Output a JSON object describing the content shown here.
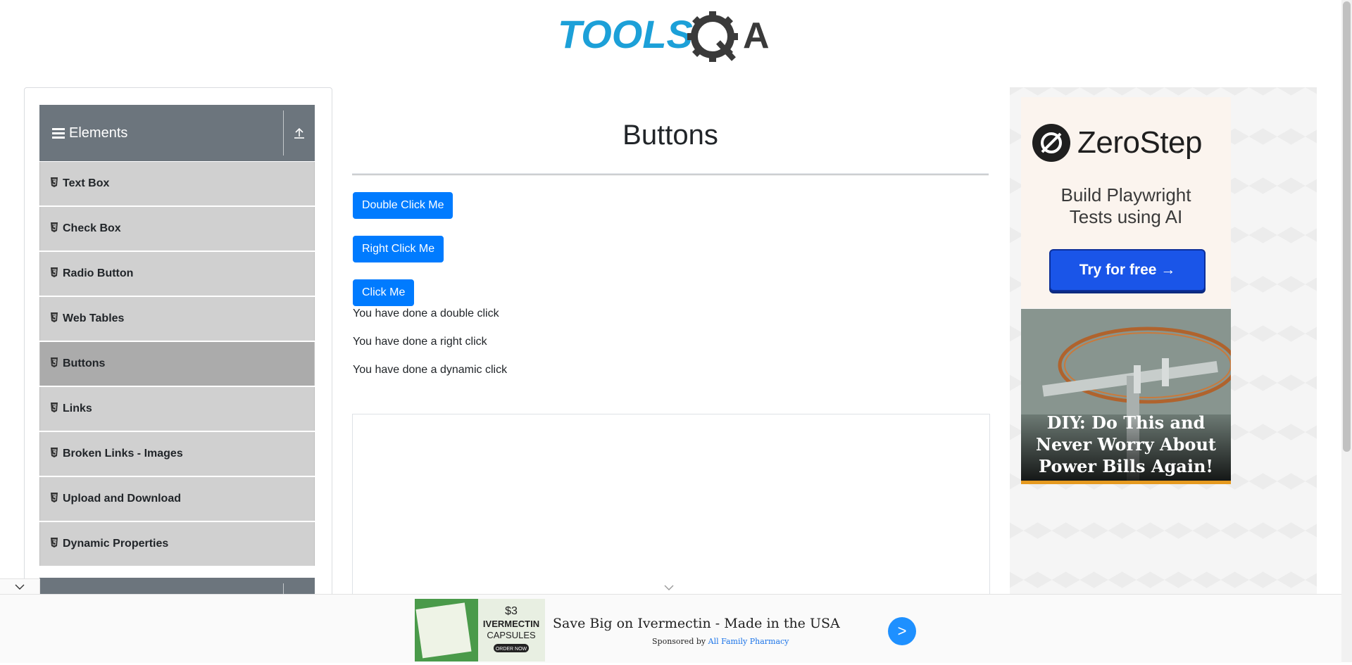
{
  "logo": {
    "text_left": "TOOLS",
    "text_right": "A"
  },
  "sidebar": {
    "group_title": "Elements",
    "items": [
      {
        "label": "Text Box",
        "active": false
      },
      {
        "label": "Check Box",
        "active": false
      },
      {
        "label": "Radio Button",
        "active": false
      },
      {
        "label": "Web Tables",
        "active": false
      },
      {
        "label": "Buttons",
        "active": true
      },
      {
        "label": "Links",
        "active": false
      },
      {
        "label": "Broken Links - Images",
        "active": false
      },
      {
        "label": "Upload and Download",
        "active": false
      },
      {
        "label": "Dynamic Properties",
        "active": false
      }
    ]
  },
  "main": {
    "title": "Buttons",
    "buttons": {
      "double_click": "Double Click Me",
      "right_click": "Right Click Me",
      "click": "Click Me"
    },
    "messages": {
      "double": "You have done a double click",
      "right": "You have done a right click",
      "dynamic": "You have done a dynamic click"
    }
  },
  "right_ad": {
    "brand": "ZeroStep",
    "tagline_line1": "Build Playwright",
    "tagline_line2": "Tests using AI",
    "cta": "Try for free →",
    "diy_headline": "DIY: Do This and Never Worry About Power Bills Again!"
  },
  "bottom_ad": {
    "image_text_price": "$3",
    "image_text_product": "IVERMECTIN",
    "image_text_form": "CAPSULES",
    "image_text_cta": "ORDER NOW",
    "title": "Save Big on Ivermectin - Made in the USA",
    "sponsored_prefix": "Sponsored by",
    "sponsor": "All Family Pharmacy",
    "go_symbol": ">"
  },
  "colors": {
    "primary_button": "#007bff",
    "sidebar_header": "#6c757d",
    "sidebar_item": "#d0d0d0",
    "sidebar_item_active": "#ababab",
    "logo_blue": "#1ca0d8",
    "logo_dark": "#3a3a3a"
  }
}
